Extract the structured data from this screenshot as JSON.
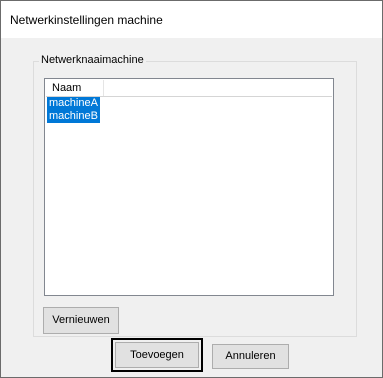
{
  "window": {
    "title": "Netwerkinstellingen machine"
  },
  "group": {
    "label": "Netwerknaaimachine"
  },
  "list": {
    "column_header": "Naam",
    "items": [
      {
        "label": "machineA",
        "selected": true
      },
      {
        "label": "machineB",
        "selected": true
      }
    ]
  },
  "buttons": {
    "refresh_label": "Vernieuwen",
    "add_label": "Toevoegen",
    "cancel_label": "Annuleren"
  },
  "colors": {
    "selection": "#0078d7",
    "dialog_background": "#f0f0f0",
    "button_face": "#e1e1e1",
    "focus_border": "#000000"
  }
}
